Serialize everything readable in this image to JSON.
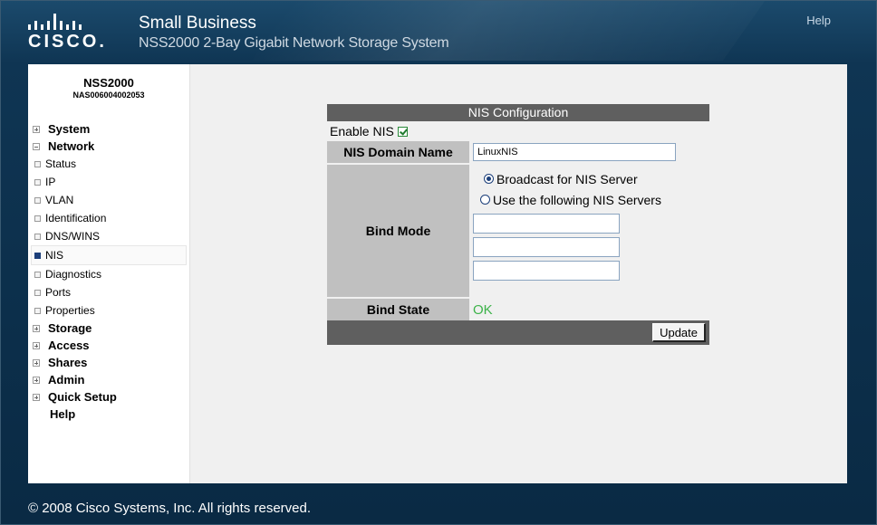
{
  "header": {
    "brand_title": "Small Business",
    "product_name": "NSS2000 2-Bay Gigabit Network Storage System",
    "logo_text": "CISCO.",
    "help_label": "Help"
  },
  "sidebar": {
    "device_name": "NSS2000",
    "device_id": "NAS006004002053",
    "items": [
      {
        "label": "System"
      },
      {
        "label": "Network"
      },
      {
        "label": "Status"
      },
      {
        "label": "IP"
      },
      {
        "label": "VLAN"
      },
      {
        "label": "Identification"
      },
      {
        "label": "DNS/WINS"
      },
      {
        "label": "NIS"
      },
      {
        "label": "Diagnostics"
      },
      {
        "label": "Ports"
      },
      {
        "label": "Properties"
      },
      {
        "label": "Storage"
      },
      {
        "label": "Access"
      },
      {
        "label": "Shares"
      },
      {
        "label": "Admin"
      },
      {
        "label": "Quick Setup"
      },
      {
        "label": "Help"
      }
    ]
  },
  "nis": {
    "title": "NIS Configuration",
    "enable_label": "Enable NIS",
    "enabled": true,
    "domain_label": "NIS Domain Name",
    "domain_value": "LinuxNIS",
    "bind_mode_label": "Bind Mode",
    "option_broadcast": "Broadcast for NIS Server",
    "option_servers": "Use the following NIS Servers",
    "selected_option": "Broadcast for NIS Server",
    "server1": "",
    "server2": "",
    "server3": "",
    "bind_state_label": "Bind State",
    "bind_state_value": "OK",
    "update_label": "Update"
  },
  "footer": {
    "copyright": "© 2008 Cisco Systems, Inc. All rights reserved."
  },
  "colors": {
    "header_bg": "#0f3553",
    "section_bar": "#5f5f5f",
    "label_bg": "#c0c0c0",
    "ok_green": "#3db34a",
    "selected_nav": "#1c3f7a"
  },
  "icons": {
    "expand": "plus-box-icon",
    "collapse": "minus-box-icon",
    "nav_bullet": "square-bullet-icon",
    "checkbox": "checkmark-icon"
  }
}
